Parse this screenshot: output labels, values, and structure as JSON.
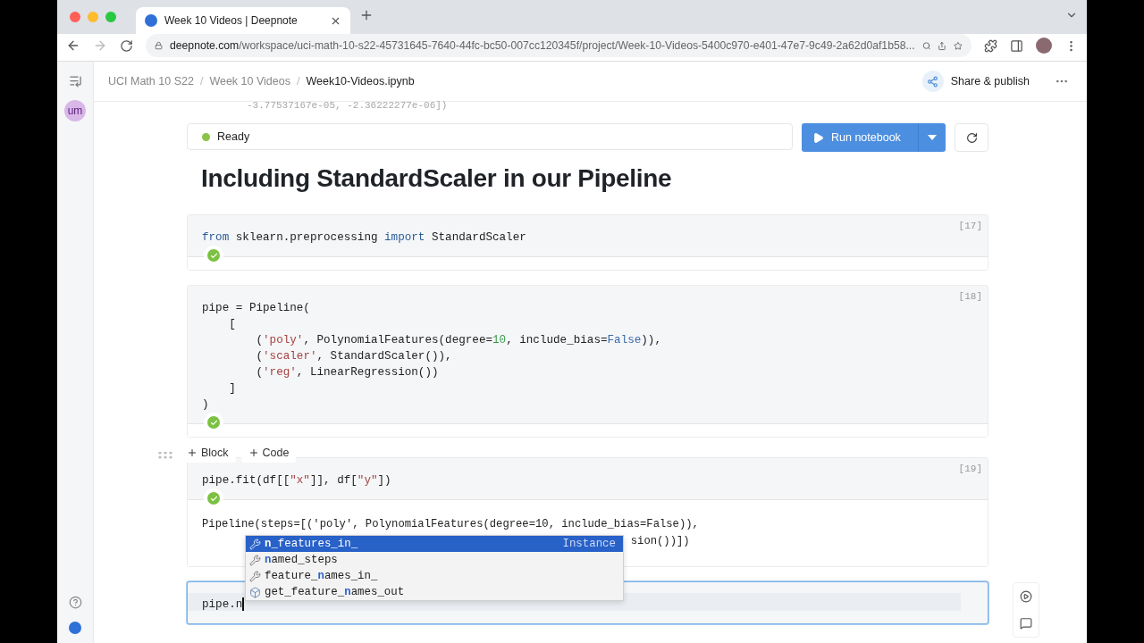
{
  "browser": {
    "tab_title": "Week 10 Videos | Deepnote",
    "url_host": "deepnote.com",
    "url_path": "/workspace/uci-math-10-s22-45731645-7640-44fc-bc50-007cc120345f/project/Week-10-Videos-5400c970-e401-47e7-9c49-2a62d0af1b58..."
  },
  "sidebar": {
    "avatar": "um"
  },
  "breadcrumbs": [
    {
      "label": "UCI Math 10 S22",
      "current": false
    },
    {
      "label": "Week 10 Videos",
      "current": false
    },
    {
      "label": "Week10-Videos.ipynb",
      "current": true
    }
  ],
  "breadcrumb_separators": [
    "/",
    "/"
  ],
  "share_label": "Share & publish",
  "scrolled_output": "-3.77537167e-05, -2.36222277e-06])",
  "status": {
    "label": "Ready",
    "color": "#8bc34a"
  },
  "run_button": "Run notebook",
  "heading": "Including StandardScaler in our Pipeline",
  "cells": [
    {
      "count": "[17]",
      "done": true,
      "editing": false,
      "lines": [
        [
          {
            "text": "from",
            "kind": "keyword"
          },
          {
            "text": " sklearn.preprocessing ",
            "kind": "plain"
          },
          {
            "text": "import",
            "kind": "keyword"
          },
          {
            "text": " StandardScaler",
            "kind": "plain"
          }
        ]
      ]
    },
    {
      "count": "[18]",
      "done": true,
      "editing": false,
      "lines": [
        [
          {
            "text": "pipe = Pipeline(",
            "kind": "plain"
          }
        ],
        [
          {
            "text": "    [",
            "kind": "plain"
          }
        ],
        [
          {
            "text": "        (",
            "kind": "plain"
          },
          {
            "text": "'poly'",
            "kind": "string"
          },
          {
            "text": ", PolynomialFeatures(degree=",
            "kind": "plain"
          },
          {
            "text": "10",
            "kind": "number"
          },
          {
            "text": ", include_bias=",
            "kind": "plain"
          },
          {
            "text": "False",
            "kind": "constant"
          },
          {
            "text": ")),",
            "kind": "plain"
          }
        ],
        [
          {
            "text": "        (",
            "kind": "plain"
          },
          {
            "text": "'scaler'",
            "kind": "string"
          },
          {
            "text": ", StandardScaler()),",
            "kind": "plain"
          }
        ],
        [
          {
            "text": "        (",
            "kind": "plain"
          },
          {
            "text": "'reg'",
            "kind": "string"
          },
          {
            "text": ", LinearRegression())",
            "kind": "plain"
          }
        ],
        [
          {
            "text": "    ]",
            "kind": "plain"
          }
        ],
        [
          {
            "text": ")",
            "kind": "plain"
          }
        ]
      ]
    },
    {
      "count": "[19]",
      "done": true,
      "editing": false,
      "lines": [
        [
          {
            "text": "pipe.fit(df[[",
            "kind": "plain"
          },
          {
            "text": "\"x\"",
            "kind": "string"
          },
          {
            "text": "]], df[",
            "kind": "plain"
          },
          {
            "text": "\"y\"",
            "kind": "string"
          },
          {
            "text": "])",
            "kind": "plain"
          }
        ]
      ],
      "output": [
        "Pipeline(steps=[('poly', PolynomialFeatures(degree=10, include_bias=False)),",
        "sion())])"
      ]
    },
    {
      "done": false,
      "editing": true,
      "lines": [
        [
          {
            "text": "pipe.n",
            "kind": "plain"
          }
        ]
      ]
    }
  ],
  "add_buttons": [
    "Block",
    "Code"
  ],
  "autocomplete": [
    {
      "label": "**n**_features_in_",
      "kind": "property",
      "detail": "Instance",
      "selected": true
    },
    {
      "label": "**n**amed_steps",
      "kind": "property",
      "selected": false
    },
    {
      "label": "feature_**n**ames_in_",
      "kind": "property",
      "selected": false
    },
    {
      "label": "get_feature_**n**ames_out",
      "kind": "method",
      "selected": false
    }
  ]
}
